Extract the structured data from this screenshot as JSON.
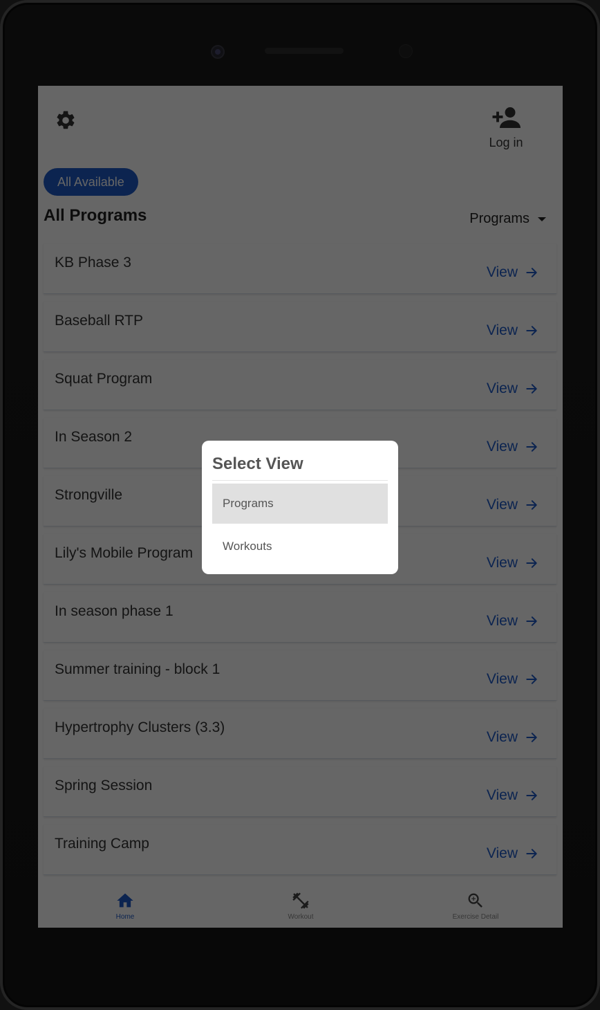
{
  "header": {
    "settings_icon": "gear-icon",
    "login_icon": "person-add-icon",
    "login_label": "Log in"
  },
  "filter_chip": "All Available",
  "section_title": "All Programs",
  "view_selector": {
    "selected": "Programs"
  },
  "programs": [
    {
      "name": "KB Phase 3",
      "action": "View"
    },
    {
      "name": "Baseball RTP",
      "action": "View"
    },
    {
      "name": "Squat Program",
      "action": "View"
    },
    {
      "name": "In Season 2",
      "action": "View"
    },
    {
      "name": "Strongville",
      "action": "View"
    },
    {
      "name": "Lily's Mobile Program",
      "action": "View"
    },
    {
      "name": "In season phase 1",
      "action": "View"
    },
    {
      "name": "Summer training - block 1",
      "action": "View"
    },
    {
      "name": "Hypertrophy Clusters (3.3)",
      "action": "View"
    },
    {
      "name": "Spring Session",
      "action": "View"
    },
    {
      "name": "Training Camp",
      "action": "View"
    }
  ],
  "bottom_nav": [
    {
      "label": "Home",
      "icon": "home-icon",
      "active": true
    },
    {
      "label": "Workout",
      "icon": "dumbbell-icon",
      "active": false
    },
    {
      "label": "Exercise Detail",
      "icon": "zoom-in-icon",
      "active": false
    }
  ],
  "dialog": {
    "title": "Select View",
    "options": [
      "Programs",
      "Workouts"
    ],
    "selected": "Programs"
  },
  "colors": {
    "accent": "#1e5ac8",
    "overlay": "rgba(0,0,0,0.6)"
  }
}
